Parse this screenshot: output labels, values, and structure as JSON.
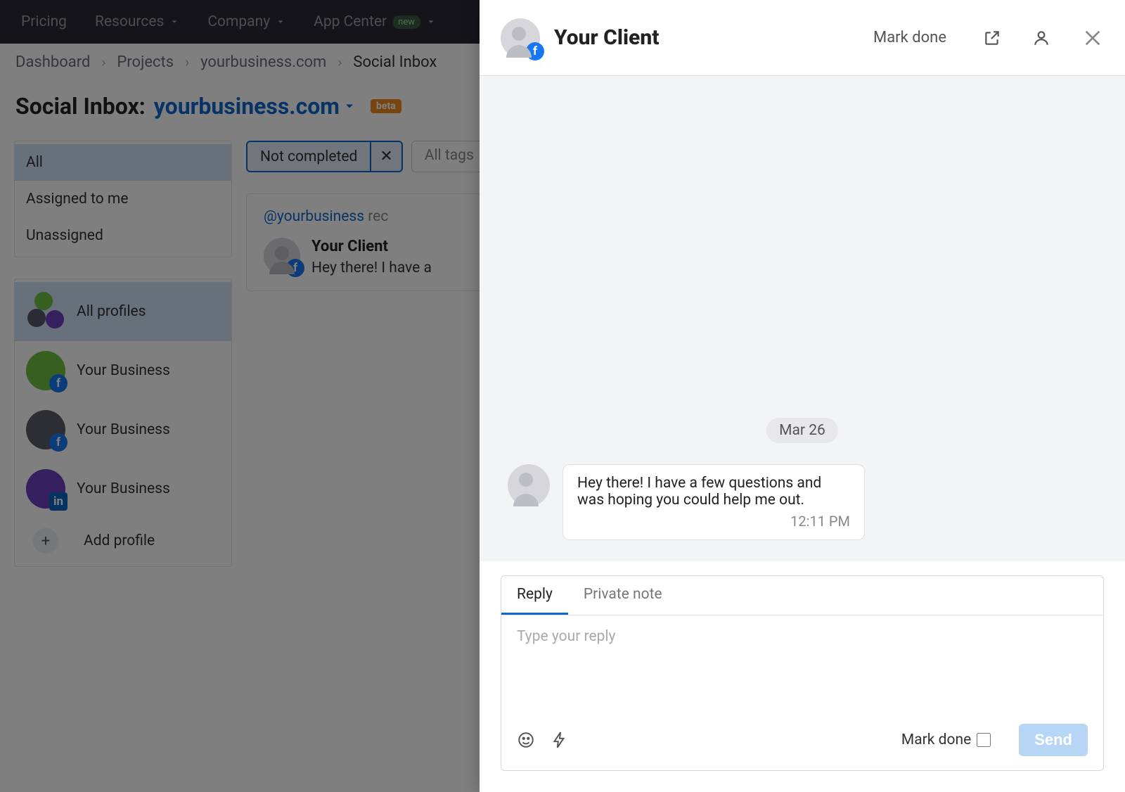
{
  "topnav": {
    "pricing": "Pricing",
    "resources": "Resources",
    "company": "Company",
    "appcenter": "App Center",
    "new_badge": "new"
  },
  "breadcrumb": {
    "dashboard": "Dashboard",
    "projects": "Projects",
    "domain": "yourbusiness.com",
    "current": "Social Inbox"
  },
  "heading": {
    "title": "Social Inbox:",
    "domain": "yourbusiness.com",
    "beta": "beta"
  },
  "filters": {
    "all": "All",
    "assigned": "Assigned to me",
    "unassigned": "Unassigned"
  },
  "profiles": {
    "all": "All profiles",
    "items": [
      {
        "label": "Your Business"
      },
      {
        "label": "Your Business"
      },
      {
        "label": "Your Business"
      }
    ],
    "add": "Add profile"
  },
  "pills": {
    "not_completed": "Not completed",
    "all_tags": "All tags"
  },
  "card": {
    "handle": "@yourbusiness",
    "suffix": "rec",
    "name": "Your Client",
    "preview": "Hey there! I have a "
  },
  "drawer": {
    "title": "Your Client",
    "mark_done": "Mark done",
    "date": "Mar 26",
    "message": "Hey there! I have a few questions and was hoping you could help me out.",
    "time": "12:11 PM",
    "tabs": {
      "reply": "Reply",
      "note": "Private note"
    },
    "placeholder": "Type your reply",
    "footer_markdone": "Mark done",
    "send": "Send"
  }
}
